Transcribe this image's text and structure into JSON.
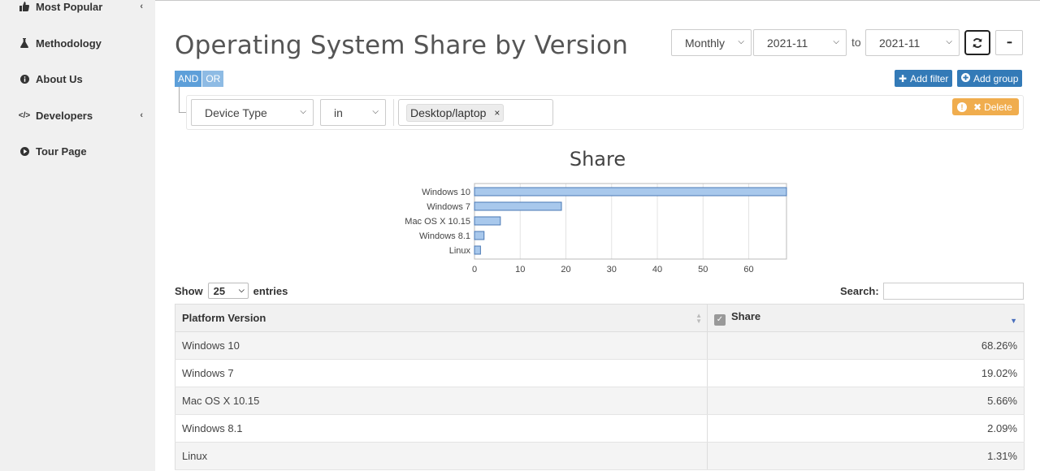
{
  "sidebar": {
    "items": [
      {
        "label": "Most Popular",
        "icon": "thumbs-up-icon",
        "has_submenu": true
      },
      {
        "label": "Methodology",
        "icon": "flask-icon",
        "has_submenu": false
      },
      {
        "label": "About Us",
        "icon": "info-circle-icon",
        "has_submenu": false
      },
      {
        "label": "Developers",
        "icon": "code-icon",
        "has_submenu": true
      },
      {
        "label": "Tour Page",
        "icon": "play-circle-icon",
        "has_submenu": false
      }
    ]
  },
  "page": {
    "title": "Operating System Share by Version"
  },
  "controls": {
    "period": "Monthly",
    "from": "2021-11",
    "to_label": "to",
    "to": "2021-11",
    "refresh_icon": "refresh-icon",
    "more_label": "•••"
  },
  "filter": {
    "and_label": "AND",
    "or_label": "OR",
    "add_filter_label": "Add filter",
    "add_group_label": "Add group",
    "field": "Device Type",
    "operator": "in",
    "value_tag": "Desktop/laptop",
    "tag_remove": "×",
    "delete_label": "Delete"
  },
  "chart_data": {
    "type": "bar",
    "orientation": "horizontal",
    "title": "Share",
    "categories": [
      "Windows 10",
      "Windows 7",
      "Mac OS X 10.15",
      "Windows 8.1",
      "Linux"
    ],
    "values": [
      68.26,
      19.02,
      5.66,
      2.09,
      1.31
    ],
    "xlim": [
      0,
      68.26
    ],
    "xticks": [
      0,
      10,
      20,
      30,
      40,
      50,
      60
    ],
    "grid": true,
    "bar_color": "#a8c8ec",
    "bar_stroke": "#4a78b4"
  },
  "table": {
    "show_label": "Show",
    "page_length": "25",
    "entries_label": "entries",
    "search_label": "Search:",
    "search_value": "",
    "columns": [
      "Platform Version",
      "Share"
    ],
    "rows": [
      [
        "Windows 10",
        "68.26%"
      ],
      [
        "Windows 7",
        "19.02%"
      ],
      [
        "Mac OS X 10.15",
        "5.66%"
      ],
      [
        "Windows 8.1",
        "2.09%"
      ],
      [
        "Linux",
        "1.31%"
      ]
    ]
  }
}
